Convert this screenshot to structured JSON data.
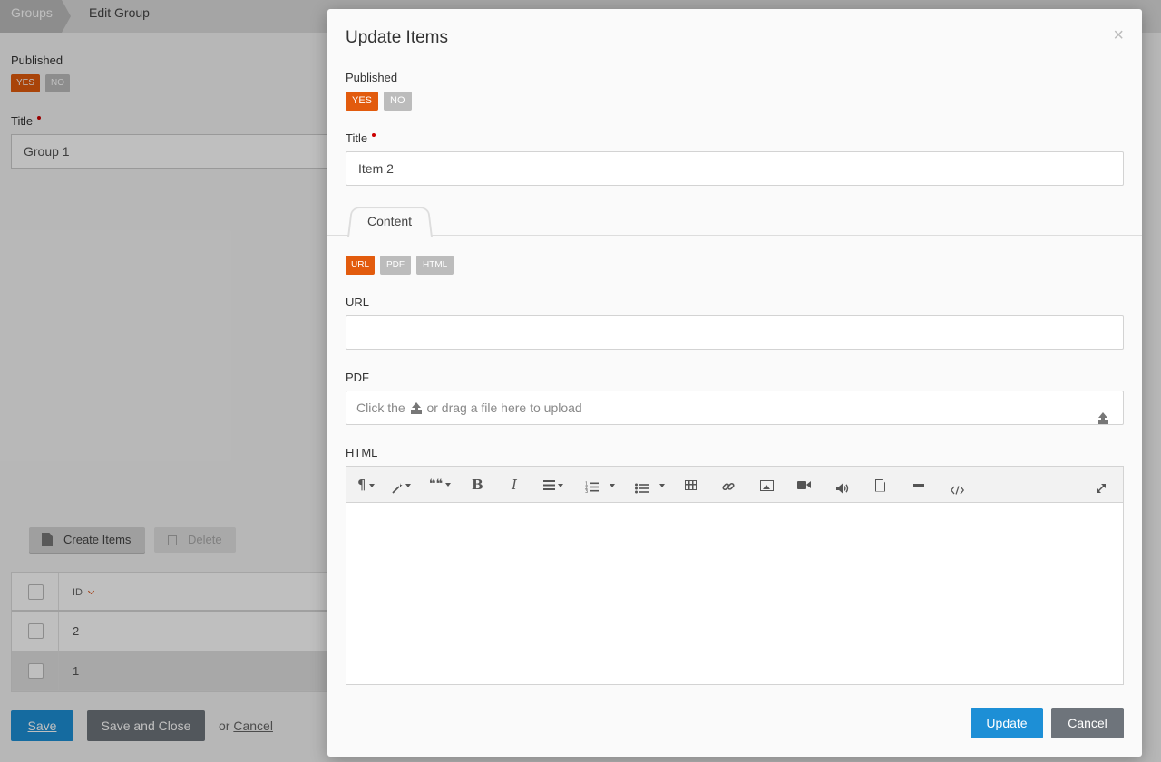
{
  "breadcrumb": {
    "root": "Groups",
    "current": "Edit Group"
  },
  "background": {
    "published_label": "Published",
    "yes": "YES",
    "no": "NO",
    "title_label": "Title",
    "title_value": "Group 1",
    "create_items": "Create Items",
    "delete": "Delete",
    "table": {
      "id_header": "ID",
      "rows": [
        "2",
        "1"
      ]
    },
    "save": "Save",
    "save_and_close": "Save and Close",
    "or": "or",
    "cancel": "Cancel"
  },
  "modal": {
    "title": "Update Items",
    "close": "×",
    "published_label": "Published",
    "yes": "YES",
    "no": "NO",
    "title_label": "Title",
    "title_value": "Item 2",
    "tab_content": "Content",
    "type_options": [
      "URL",
      "PDF",
      "HTML"
    ],
    "selected_type": "URL",
    "url_label": "URL",
    "url_value": "",
    "pdf_label": "PDF",
    "pdf_placeholder_before": "Click the",
    "pdf_placeholder_after": "or drag a file here to upload",
    "html_label": "HTML",
    "toolbar_icons": [
      "paragraph-icon",
      "magic-wand-icon",
      "quote-icon",
      "bold-icon",
      "italic-icon",
      "align-icon",
      "ordered-list-icon",
      "unordered-list-icon",
      "table-icon",
      "link-icon",
      "image-icon",
      "video-icon",
      "audio-icon",
      "file-icon",
      "horizontal-rule-icon",
      "code-view-icon",
      "fullscreen-icon"
    ],
    "toolbar_glyphs": {
      "paragraph": "¶",
      "quote": "❝❝",
      "bold": "B",
      "italic": "I",
      "ordered": "1⃣",
      "link": "🔗"
    },
    "update": "Update",
    "cancel": "Cancel"
  },
  "colors": {
    "accent_orange": "#e25b0d",
    "primary_blue": "#1d8fd6",
    "secondary_gray": "#6e747b"
  }
}
